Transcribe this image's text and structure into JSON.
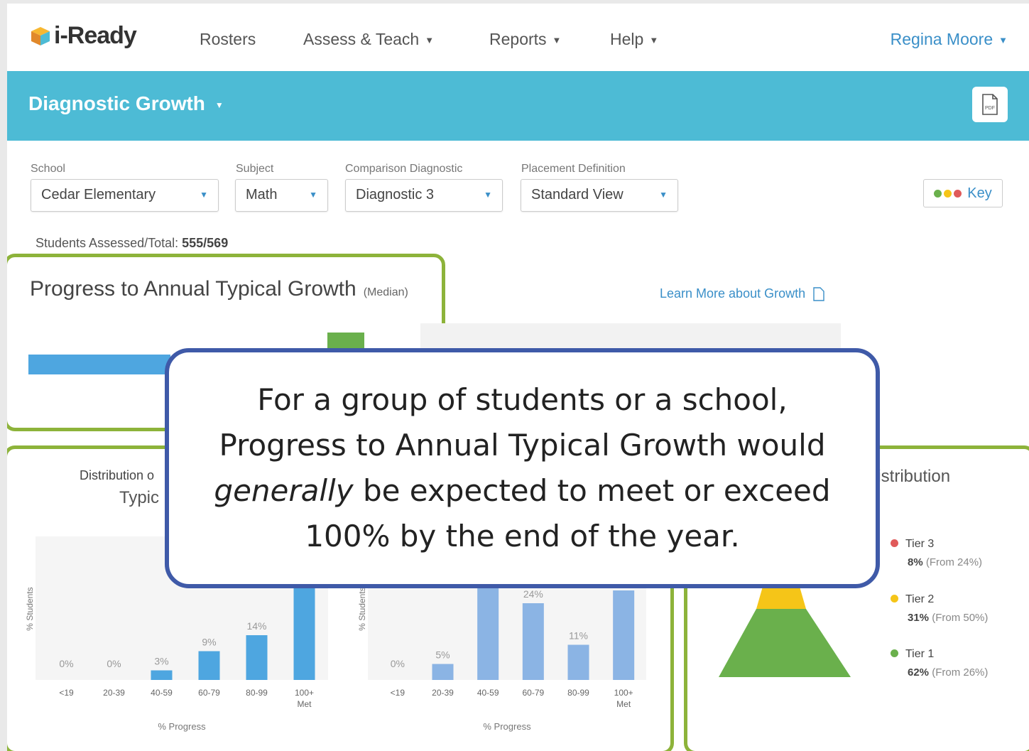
{
  "nav": {
    "logo": "i-Ready",
    "items": [
      {
        "label": "Rosters",
        "dropdown": false
      },
      {
        "label": "Assess & Teach",
        "dropdown": true
      },
      {
        "label": "Reports",
        "dropdown": true
      },
      {
        "label": "Help",
        "dropdown": true
      }
    ],
    "user": "Regina Moore"
  },
  "header": {
    "title": "Diagnostic Growth",
    "pdf_label": "PDF"
  },
  "filters": [
    {
      "label": "School",
      "value": "Cedar Elementary"
    },
    {
      "label": "Subject",
      "value": "Math"
    },
    {
      "label": "Comparison Diagnostic",
      "value": "Diagnostic 3"
    },
    {
      "label": "Placement Definition",
      "value": "Standard View"
    }
  ],
  "key_label": "Key",
  "key_colors": [
    "#6ab04c",
    "#f5c518",
    "#e05a5a"
  ],
  "students_assessed": {
    "label": "Students Assessed/Total:",
    "value": "555/569"
  },
  "progress": {
    "title": "Progress to Annual Typical Growth",
    "qualifier": "(Median)",
    "learn_more": "Learn More about Growth"
  },
  "distribution_left": {
    "title_line1": "Distribution o",
    "title_line2": "Typic"
  },
  "distribution_right_title": "Distribution",
  "chart_data": [
    {
      "type": "bar",
      "categories": [
        "<19",
        "20-39",
        "40-59",
        "60-79",
        "80-99",
        "100+ Met"
      ],
      "values": [
        0,
        0,
        3,
        9,
        14,
        null
      ],
      "labels": [
        "0%",
        "0%",
        "3%",
        "9%",
        "14%",
        ""
      ],
      "ylabel": "% Students",
      "xlabel": "% Progress",
      "color": "#4ea6e0"
    },
    {
      "type": "bar",
      "categories": [
        "<19",
        "20-39",
        "40-59",
        "60-79",
        "80-99",
        "100+ Met"
      ],
      "values": [
        0,
        5,
        32,
        24,
        11,
        28
      ],
      "labels": [
        "0%",
        "5%",
        "32%",
        "24%",
        "11%",
        "28%"
      ],
      "ylabel": "% Students",
      "xlabel": "% Progress",
      "color": "#8bb4e4"
    }
  ],
  "tiers": [
    {
      "name": "Tier 3",
      "pct": "8%",
      "from": "(From 24%)",
      "color": "#e05a5a"
    },
    {
      "name": "Tier 2",
      "pct": "31%",
      "from": "(From 50%)",
      "color": "#f5c518"
    },
    {
      "name": "Tier 1",
      "pct": "62%",
      "from": "(From 26%)",
      "color": "#6ab04c"
    }
  ],
  "callout": {
    "before": "For a group of students or a school, Progress to Annual Typical Growth would ",
    "emphasis": "generally",
    "after": " be expected to meet or exceed 100% by the end of the year."
  }
}
